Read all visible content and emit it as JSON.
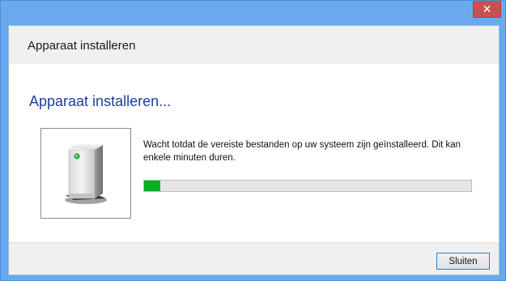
{
  "titlebar": {
    "close_glyph": "✕"
  },
  "window": {
    "title": "Apparaat installeren"
  },
  "main": {
    "heading": "Apparaat installeren...",
    "device_icon": "device-icon",
    "message": "Wacht totdat de vereiste bestanden op uw systeem zijn geïnstalleerd. Dit kan enkele minuten duren.",
    "progress_fraction": 0.05
  },
  "footer": {
    "close_label": "Sluiten"
  },
  "colors": {
    "titlebar": "#6aa9ee",
    "heading": "#1e3f9c",
    "progress_fill": "#06b025",
    "close_red": "#c75050"
  }
}
